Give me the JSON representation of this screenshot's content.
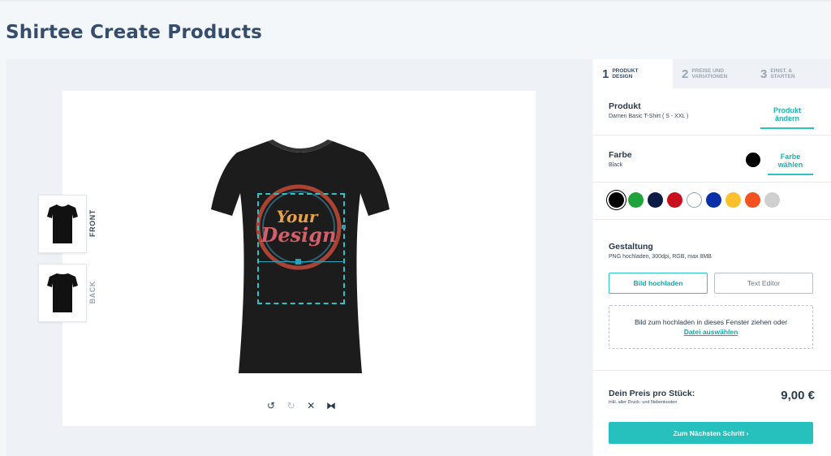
{
  "page": {
    "title": "Shirtee Create Products"
  },
  "views": {
    "front_label": "FRONT",
    "back_label": "BACK"
  },
  "design": {
    "line1": "Your",
    "line2": "Design"
  },
  "tools": [
    {
      "name": "undo-icon",
      "glyph": "↺"
    },
    {
      "name": "redo-icon",
      "glyph": "↻"
    },
    {
      "name": "delete-icon",
      "glyph": "✕"
    },
    {
      "name": "flip-icon",
      "glyph": "⧓"
    }
  ],
  "tabs": [
    {
      "num": "1",
      "line1": "PRODUKT",
      "line2": "DESIGN",
      "active": true
    },
    {
      "num": "2",
      "line1": "PREISE UND",
      "line2": "VARIATIONEN",
      "active": false
    },
    {
      "num": "3",
      "line1": "EINST. &",
      "line2": "STARTEN",
      "active": false
    }
  ],
  "product": {
    "title": "Produkt",
    "name": "Damen Basic T-Shirt  ( S - XXL )",
    "change_label": "Produkt ändern"
  },
  "color": {
    "title": "Farbe",
    "current": "Black",
    "current_hex": "#000000",
    "choose_label": "Farbe wählen",
    "swatches": [
      "#000000",
      "#1fa33a",
      "#0c1a44",
      "#c8101e",
      "#ffffff",
      "#0a2fa8",
      "#fbc02d",
      "#f4511e",
      "#cfcfcf"
    ]
  },
  "gestaltung": {
    "title": "Gestaltung",
    "info": "PNG hochladen, 300dpi, RGB, max 8MB",
    "upload_label": "Bild hochladen",
    "text_editor_label": "Text Editor",
    "drop_text": "Bild zum hochladen in dieses Fenster ziehen oder",
    "drop_link": "Datei auswählen"
  },
  "price": {
    "title": "Dein Preis pro Stück:",
    "note": "Inkl. aller Druck- und Nebenkosten",
    "value": "9,00 €"
  },
  "next": {
    "label": "Zum Nächsten Schritt  ›"
  },
  "colors": {
    "accent": "#2bc3c3",
    "title": "#354c6c"
  }
}
